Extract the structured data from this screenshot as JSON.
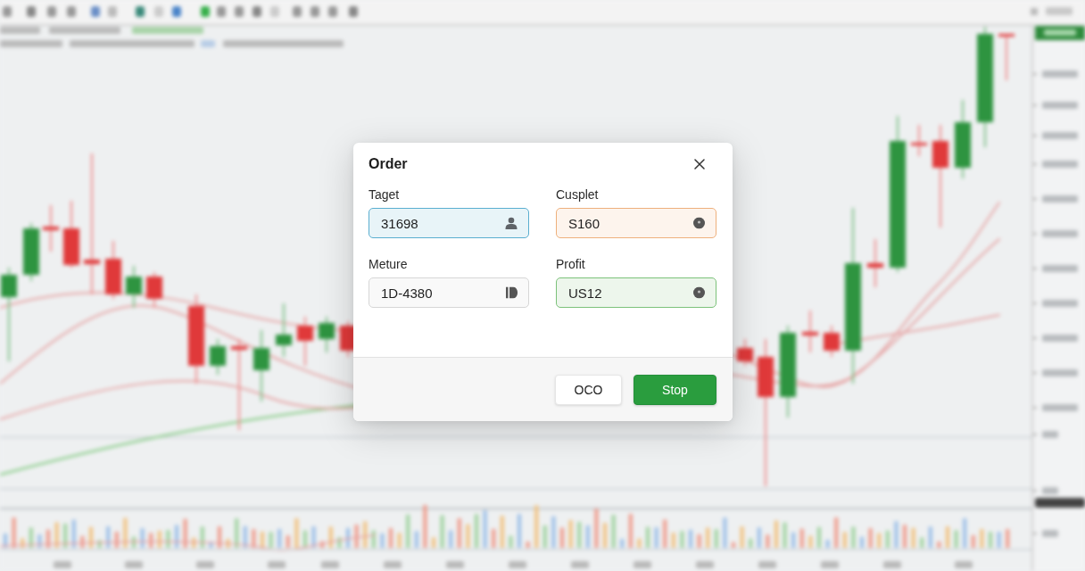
{
  "dialog": {
    "title": "Order",
    "fields": [
      {
        "label": "Taget",
        "value": "31698",
        "color": "#5aaed0"
      },
      {
        "label": "Cusplet",
        "value": "S160",
        "color": "#eeb07c"
      },
      {
        "label": "Meture",
        "value": "1D-4380",
        "color": "#d6d6d6"
      },
      {
        "label": "Profit",
        "value": "US12",
        "color": "#7cc27a"
      }
    ],
    "buttons": [
      {
        "label": "OCO",
        "kind": "secondary"
      },
      {
        "label": "Stop",
        "kind": "primary"
      }
    ]
  }
}
